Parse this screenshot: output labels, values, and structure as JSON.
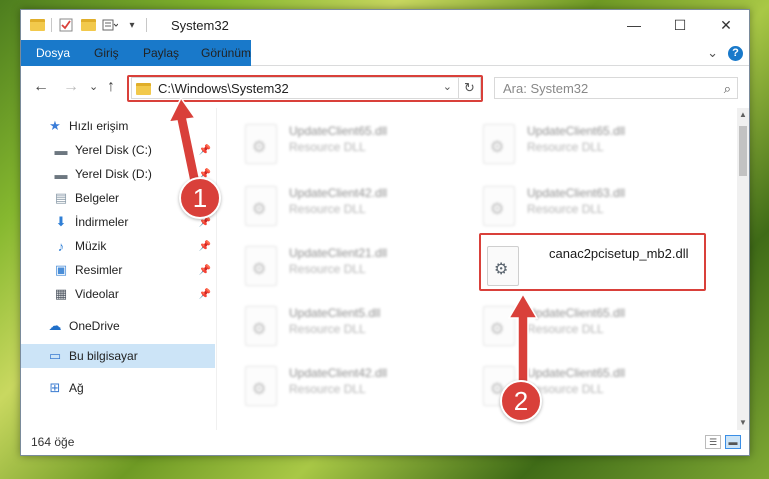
{
  "window": {
    "title": "System32",
    "controls": {
      "minimize": "—",
      "maximize": "☐",
      "close": "✕"
    }
  },
  "ribbon": {
    "tabs": [
      "Dosya",
      "Giriş",
      "Paylaş",
      "Görünüm"
    ],
    "expand": "⌄",
    "help": "?"
  },
  "nav": {
    "back": "←",
    "forward": "→",
    "recent": "⌄",
    "up": "↑",
    "address": "C:\\Windows\\System32",
    "address_dropdown": "⌄",
    "refresh": "↻",
    "search_placeholder": "Ara: System32",
    "search_icon": "⌕"
  },
  "sidebar": {
    "items": [
      {
        "label": "Hızlı erişim",
        "icon": "star-icon",
        "glyph": "★",
        "color": "#3b7dd8",
        "pinned": false
      },
      {
        "label": "Yerel Disk (C:)",
        "icon": "drive-icon",
        "glyph": "▬",
        "color": "#6d7780",
        "pinned": true
      },
      {
        "label": "Yerel Disk (D:)",
        "icon": "drive-icon",
        "glyph": "▬",
        "color": "#6d7780",
        "pinned": true
      },
      {
        "label": "Belgeler",
        "icon": "documents-icon",
        "glyph": "▤",
        "color": "#8a9aa8",
        "pinned": true
      },
      {
        "label": "İndirmeler",
        "icon": "download-icon",
        "glyph": "⬇",
        "color": "#2f7fd6",
        "pinned": true
      },
      {
        "label": "Müzik",
        "icon": "music-icon",
        "glyph": "♪",
        "color": "#2f7fd6",
        "pinned": true
      },
      {
        "label": "Resimler",
        "icon": "pictures-icon",
        "glyph": "▣",
        "color": "#4a8ed8",
        "pinned": true
      },
      {
        "label": "Videolar",
        "icon": "video-icon",
        "glyph": "▦",
        "color": "#4d5560",
        "pinned": true
      },
      {
        "label": "OneDrive",
        "icon": "cloud-icon",
        "glyph": "☁",
        "color": "#1f6fc9",
        "pinned": false
      },
      {
        "label": "Bu bilgisayar",
        "icon": "computer-icon",
        "glyph": "▭",
        "color": "#3a7bd0",
        "pinned": false,
        "selected": true
      },
      {
        "label": "Ağ",
        "icon": "network-icon",
        "glyph": "⊞",
        "color": "#3a7bd0",
        "pinned": false
      }
    ],
    "pin_glyph": "📌"
  },
  "files": [
    {
      "name": "UpdateClient65.dll",
      "type": "Resource DLL",
      "blurred": true
    },
    {
      "name": "UpdateClient65.dll",
      "type": "Resource DLL",
      "blurred": true
    },
    {
      "name": "UpdateClient42.dll",
      "type": "Resource DLL",
      "blurred": true
    },
    {
      "name": "UpdateClient63.dll",
      "type": "Resource DLL",
      "blurred": true
    },
    {
      "name": "UpdateClient21.dll",
      "type": "Resource DLL",
      "blurred": true
    },
    {
      "name": "canac2pcisetup_mb2.dll",
      "type": "",
      "blurred": false
    },
    {
      "name": "UpdateClient5.dll",
      "type": "Resource DLL",
      "blurred": true
    },
    {
      "name": "UpdateClient65.dll",
      "type": "Resource DLL",
      "blurred": true
    },
    {
      "name": "UpdateClient42.dll",
      "type": "Resource DLL",
      "blurred": true
    },
    {
      "name": "UpdateClient65.dll",
      "type": "Resource DLL",
      "blurred": true
    }
  ],
  "status": {
    "count": "164 öğe"
  },
  "annotations": {
    "step1": "1",
    "step2": "2",
    "color": "#d9403a"
  }
}
